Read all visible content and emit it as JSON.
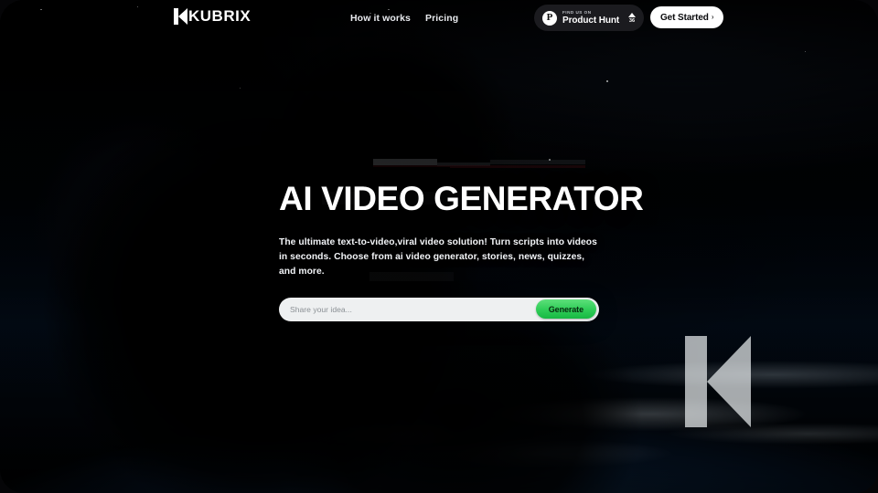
{
  "brand": {
    "name": "KUBRIX",
    "logo_icon": "kubrix-k-mark-icon",
    "watermark_icon": "kubrix-k-watermark-icon"
  },
  "nav": {
    "links": [
      {
        "label": "How it works"
      },
      {
        "label": "Pricing"
      }
    ]
  },
  "product_hunt": {
    "logo_icon": "product-hunt-p-icon",
    "logo_letter": "P",
    "eyebrow": "FIND US ON",
    "name": "Product Hunt",
    "upvote_icon": "caret-up-icon",
    "upvote_count": "36"
  },
  "cta": {
    "label": "Get Started",
    "chevron": "›",
    "chevron_icon": "chevron-right-icon"
  },
  "hero": {
    "headline": "AI VIDEO GENERATOR",
    "subcopy": "The ultimate text-to-video,viral video solution! Turn scripts into videos in seconds. Choose from ai video generator, stories, news, quizzes, and more."
  },
  "search": {
    "value": "",
    "placeholder": "Share your idea...",
    "generate_label": "Generate"
  },
  "colors": {
    "accent_green": "#2ecc57",
    "page_black": "#050507",
    "earth_blue": "#2e6289",
    "badge_dark": "#1b1b1f",
    "text_white": "#ffffff"
  }
}
